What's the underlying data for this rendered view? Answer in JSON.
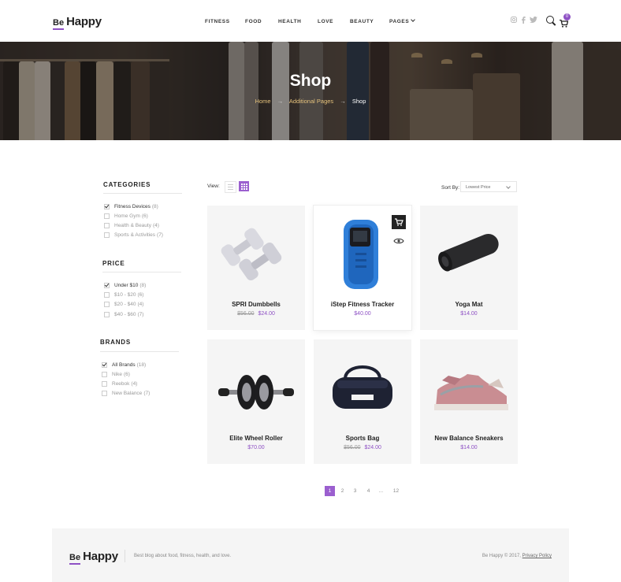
{
  "brand": {
    "be": "Be",
    "happy": "Happy"
  },
  "nav": {
    "items": [
      {
        "label": "FITNESS"
      },
      {
        "label": "FOOD"
      },
      {
        "label": "HEALTH"
      },
      {
        "label": "LOVE"
      },
      {
        "label": "BEAUTY"
      },
      {
        "label": "PAGES"
      }
    ]
  },
  "header_icons": {
    "social": [
      "instagram-icon",
      "facebook-icon",
      "twitter-icon"
    ],
    "search": "search-icon",
    "cart": "cart-icon",
    "cart_count": "0"
  },
  "banner": {
    "title": "Shop",
    "breadcrumb": {
      "home": "Home",
      "middle": "Additional Pages",
      "current": "Shop",
      "separator": "→"
    }
  },
  "sidebar": {
    "categories": {
      "title": "CATEGORIES",
      "items": [
        {
          "label": "Fitness Devices",
          "count": "(8)",
          "checked": true
        },
        {
          "label": "Home Gym",
          "count": "(6)",
          "checked": false
        },
        {
          "label": "Health & Beauty",
          "count": "(4)",
          "checked": false
        },
        {
          "label": "Sports & Activities",
          "count": "(7)",
          "checked": false
        }
      ]
    },
    "price": {
      "title": "PRICE",
      "items": [
        {
          "label": "Under $10",
          "count": "(8)",
          "checked": true
        },
        {
          "label": "$10 - $20",
          "count": "(6)",
          "checked": false
        },
        {
          "label": "$20 - $40",
          "count": "(4)",
          "checked": false
        },
        {
          "label": "$40 - $60",
          "count": "(7)",
          "checked": false
        }
      ]
    },
    "brands": {
      "title": "BRANDS",
      "items": [
        {
          "label": "All Brands",
          "count": "(18)",
          "checked": true
        },
        {
          "label": "Nike",
          "count": "(6)",
          "checked": false
        },
        {
          "label": "Reebok",
          "count": "(4)",
          "checked": false
        },
        {
          "label": "New Balance",
          "count": "(7)",
          "checked": false
        }
      ]
    }
  },
  "toolbar": {
    "view_label": "View:",
    "sort_label": "Sort By:",
    "sort_value": "Lowest Price"
  },
  "products": [
    {
      "name": "SPRI Dumbbells",
      "old_price": "$56.00",
      "price": "$24.00"
    },
    {
      "name": "iStep Fitness Tracker",
      "old_price": "",
      "price": "$40.00"
    },
    {
      "name": "Yoga Mat",
      "old_price": "",
      "price": "$14.00"
    },
    {
      "name": "Elite Wheel Roller",
      "old_price": "",
      "price": "$70.00"
    },
    {
      "name": "Sports Bag",
      "old_price": "$56.00",
      "price": "$24.00"
    },
    {
      "name": "New Balance Sneakers",
      "old_price": "",
      "price": "$14.00"
    }
  ],
  "pagination": [
    "1",
    "2",
    "3",
    "4",
    "...",
    "12"
  ],
  "footer": {
    "tagline": "Best blog about food, fitness, health, and love.",
    "copyright": "Be Happy © 2017,",
    "privacy": "Privacy Policy"
  },
  "colors": {
    "accent": "#8e51c4",
    "price": "#8e51c4",
    "breadcrumb_link": "#e5c27c"
  }
}
